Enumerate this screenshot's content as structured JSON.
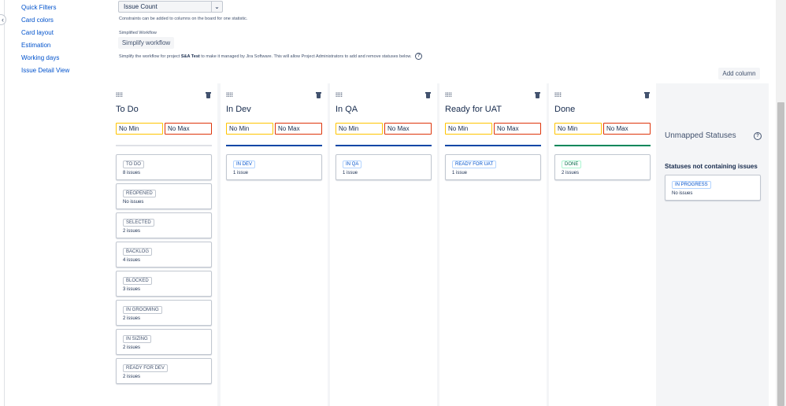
{
  "sidebar": {
    "items": [
      {
        "label": "Quick Filters"
      },
      {
        "label": "Card colors"
      },
      {
        "label": "Card layout"
      },
      {
        "label": "Estimation"
      },
      {
        "label": "Working days"
      },
      {
        "label": "Issue Detail View"
      }
    ],
    "collapse_icon": "chevron-left-icon"
  },
  "constraint": {
    "selected": "Issue Count",
    "description": "Constraints can be added to columns on the board for one statistic."
  },
  "simplified_workflow": {
    "label": "Simplified Workflow",
    "button": "Simplify workflow",
    "desc_prefix": "Simplify the workflow for project",
    "project": "S&A Test",
    "desc_suffix": "to make it managed by Jira Software. This will allow Project Administrators to add and remove statuses below."
  },
  "add_column": "Add column",
  "colors": {
    "accent": "#0052cc",
    "todo_line": "#dfe1e6",
    "progress_line": "#0747a6",
    "done_line": "#00875a",
    "min_border": "#ffc400",
    "max_border": "#de350b"
  },
  "columns": [
    {
      "name": "To Do",
      "min": "No Min",
      "max": "No Max",
      "statuses": [
        {
          "label": "TO DO",
          "count": "8 issues"
        },
        {
          "label": "REOPENED",
          "count": "No issues"
        },
        {
          "label": "SELECTED",
          "count": "2 issues"
        },
        {
          "label": "BACKLOG",
          "count": "4 issues"
        },
        {
          "label": "BLOCKED",
          "count": "3 issues"
        },
        {
          "label": "IN GROOMING",
          "count": "2 issues"
        },
        {
          "label": "IN SIZING",
          "count": "2 issues"
        },
        {
          "label": "READY FOR DEV",
          "count": "2 issues"
        }
      ]
    },
    {
      "name": "In Dev",
      "min": "No Min",
      "max": "No Max",
      "statuses": [
        {
          "label": "IN DEV",
          "count": "1 issue"
        }
      ]
    },
    {
      "name": "In QA",
      "min": "No Min",
      "max": "No Max",
      "statuses": [
        {
          "label": "IN QA",
          "count": "1 issue"
        }
      ]
    },
    {
      "name": "Ready for UAT",
      "min": "No Min",
      "max": "No Max",
      "statuses": [
        {
          "label": "READY FOR UAT",
          "count": "1 issue"
        }
      ]
    },
    {
      "name": "Done",
      "min": "No Min",
      "max": "No Max",
      "statuses": [
        {
          "label": "DONE",
          "count": "2 issues"
        }
      ]
    }
  ],
  "unmapped": {
    "title": "Unmapped Statuses",
    "subtitle": "Statuses not containing issues",
    "statuses": [
      {
        "label": "IN PROGRESS",
        "count": "No issues"
      }
    ]
  }
}
